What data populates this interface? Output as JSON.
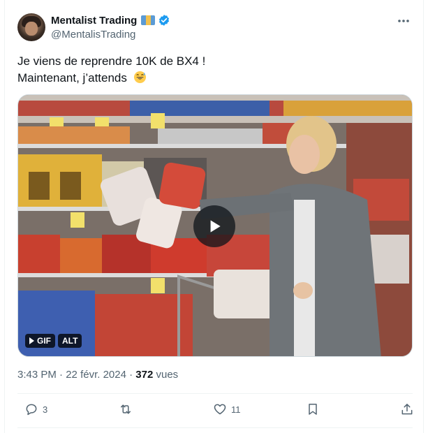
{
  "author": {
    "display_name": "Mentalist Trading",
    "handle": "@MentalisTrading",
    "flag_colors": [
      "#5b9bd5",
      "#f2c14e",
      "#5b9bd5"
    ],
    "verified_color": "#1d9bf0"
  },
  "tweet": {
    "line1": "Je viens de reprendre 10K de BX4 !",
    "line2": "Maintenant, j’attends",
    "emoji": "grinning-sweat-emoji"
  },
  "media": {
    "gif_label": "GIF",
    "alt_label": "ALT",
    "play_icon": "play-icon"
  },
  "meta": {
    "time": "3:43 PM",
    "separator": "·",
    "date": "22 févr. 2024",
    "views_count": "372",
    "views_label": "vues"
  },
  "actions": {
    "replies": "3",
    "reposts": "",
    "likes": "11",
    "bookmark": "",
    "share": ""
  }
}
